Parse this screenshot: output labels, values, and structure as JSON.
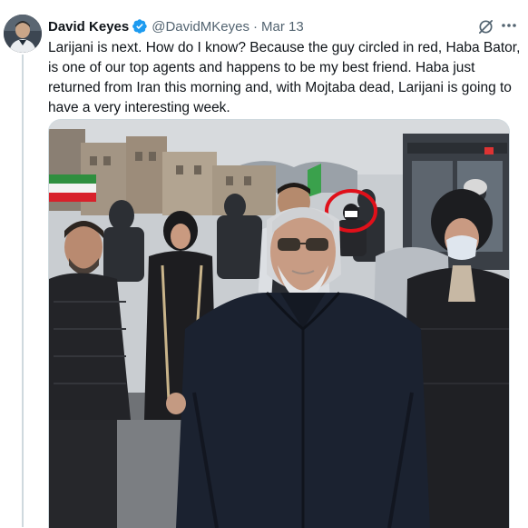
{
  "tweet": {
    "author": {
      "display_name": "David Keyes",
      "handle": "@DavidMKeyes",
      "verified": true,
      "verified_color": "#1d9bf0"
    },
    "separator": "·",
    "date": "Mar 13",
    "text": "Larijani is next. How do I know? Because the guy circled in red, Haba Bator, is one of our top agents and happens to be my best friend. Haba just returned from Iran this morning and, with Mojtaba dead, Larijani is going to have a very interesting week.",
    "icons": [
      "grok-icon",
      "more-icon",
      "verified-badge-icon"
    ],
    "media": {
      "type": "photo",
      "circle_color": "#e0101a"
    }
  }
}
